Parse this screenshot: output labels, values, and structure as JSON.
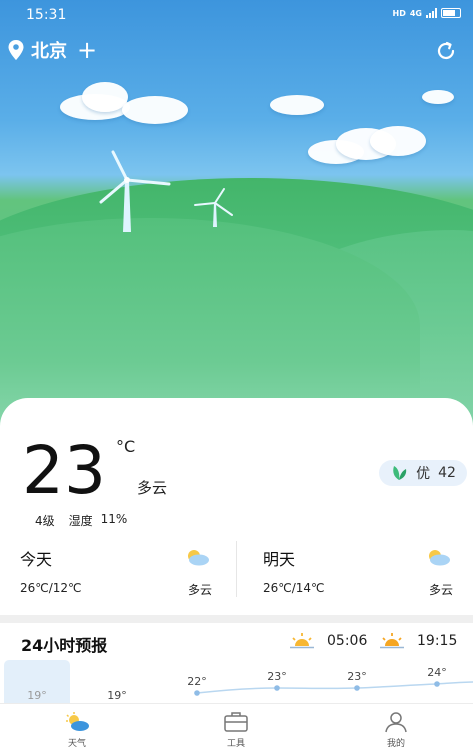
{
  "status_bar": {
    "time": "15:31",
    "hd": "HD",
    "network": "4G"
  },
  "header": {
    "city": "北京",
    "add": "+"
  },
  "current": {
    "temperature": "23",
    "unit": "°C",
    "condition": "多云",
    "aqi_label": "优",
    "aqi_value": "42",
    "wind": "4级",
    "humidity_label": "湿度",
    "humidity_value": "11%"
  },
  "days": [
    {
      "name": "今天",
      "range": "26℃/12℃",
      "condition": "多云",
      "icon": "partly-cloudy-icon"
    },
    {
      "name": "明天",
      "range": "26℃/14℃",
      "condition": "多云",
      "icon": "partly-cloudy-icon"
    }
  ],
  "forecast": {
    "title": "24小时预报",
    "sunrise": "05:06",
    "sunset": "19:15",
    "hours": [
      {
        "temp": "19°"
      },
      {
        "temp": "19°"
      },
      {
        "temp": "22°"
      },
      {
        "temp": "23°"
      },
      {
        "temp": "23°"
      },
      {
        "temp": "24°"
      }
    ]
  },
  "nav": [
    {
      "label": "天气",
      "icon": "weather-icon"
    },
    {
      "label": "工具",
      "icon": "toolbox-icon"
    },
    {
      "label": "我的",
      "icon": "profile-icon"
    }
  ],
  "colors": {
    "sky": "#3d95dd",
    "hills": "#5cc48a",
    "aqi_bg": "#e8f1fb",
    "accent": "#3d95dd"
  }
}
